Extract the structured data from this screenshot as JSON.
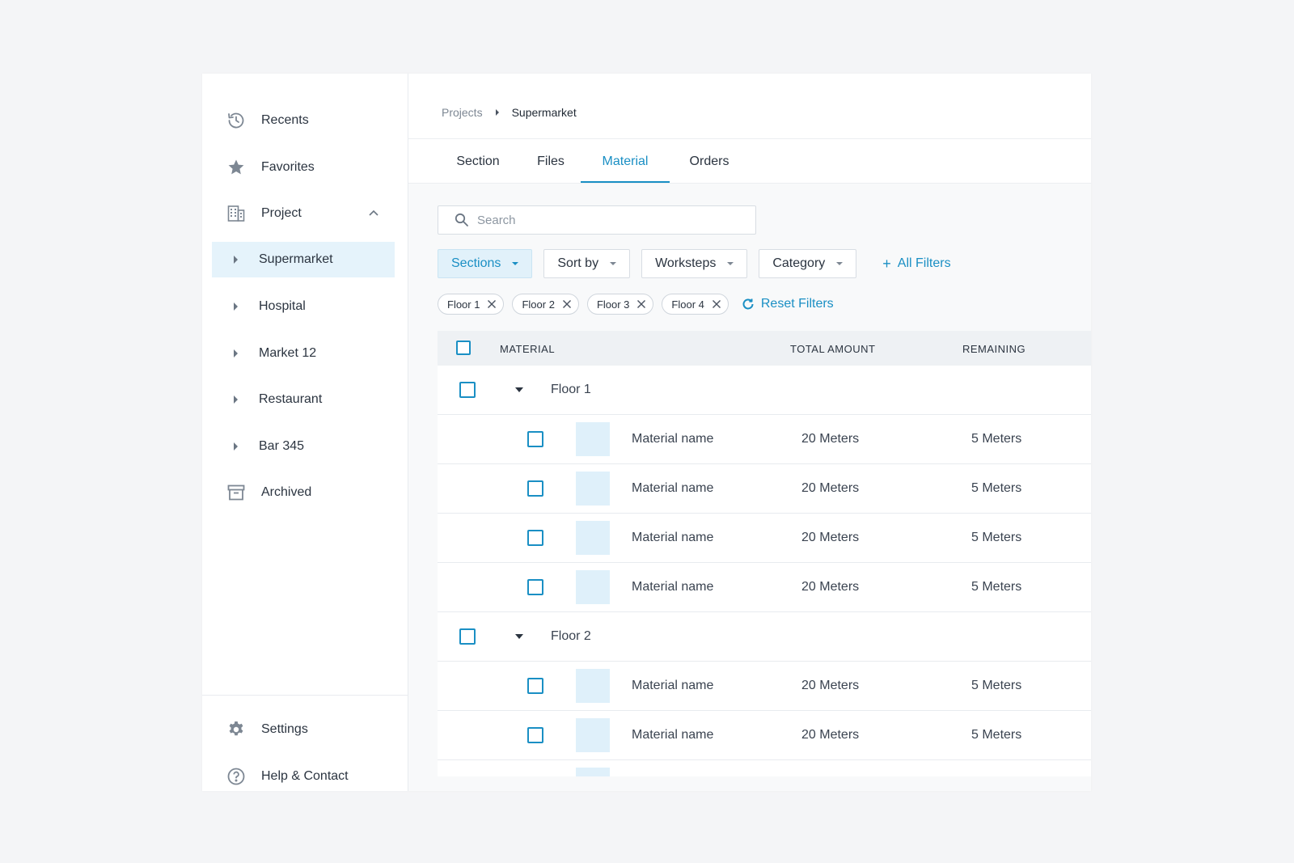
{
  "sidebar": {
    "items": [
      {
        "label": "Recents",
        "icon": "history-icon"
      },
      {
        "label": "Favorites",
        "icon": "star-icon"
      },
      {
        "label": "Project",
        "icon": "building-icon"
      }
    ],
    "projects": [
      {
        "label": "Supermarket",
        "active": true
      },
      {
        "label": "Hospital"
      },
      {
        "label": "Market 12"
      },
      {
        "label": "Restaurant"
      },
      {
        "label": "Bar 345"
      }
    ],
    "archived": {
      "label": "Archived",
      "icon": "archive-icon"
    },
    "footer": [
      {
        "label": "Settings",
        "icon": "gear-icon"
      },
      {
        "label": "Help & Contact",
        "icon": "help-icon"
      }
    ]
  },
  "breadcrumb": {
    "root": "Projects",
    "current": "Supermarket"
  },
  "tabs": [
    {
      "label": "Section"
    },
    {
      "label": "Files"
    },
    {
      "label": "Material",
      "active": true
    },
    {
      "label": "Orders"
    }
  ],
  "search": {
    "placeholder": "Search",
    "value": ""
  },
  "filters": {
    "buttons": [
      {
        "label": "Sections",
        "active": true
      },
      {
        "label": "Sort by"
      },
      {
        "label": "Worksteps"
      },
      {
        "label": "Category"
      }
    ],
    "all_filters_label": "All Filters",
    "chips": [
      "Floor 1",
      "Floor 2",
      "Floor 3",
      "Floor 4"
    ],
    "reset_label": "Reset Filters"
  },
  "table": {
    "headers": {
      "material": "MATERIAL",
      "total": "TOTAL AMOUNT",
      "remaining": "REMAINING"
    },
    "groups": [
      {
        "name": "Floor 1",
        "rows": [
          {
            "material": "Material name",
            "total": "20 Meters",
            "remaining": "5 Meters"
          },
          {
            "material": "Material name",
            "total": "20 Meters",
            "remaining": "5 Meters"
          },
          {
            "material": "Material name",
            "total": "20 Meters",
            "remaining": "5 Meters"
          },
          {
            "material": "Material name",
            "total": "20 Meters",
            "remaining": "5 Meters"
          }
        ]
      },
      {
        "name": "Floor 2",
        "rows": [
          {
            "material": "Material name",
            "total": "20 Meters",
            "remaining": "5 Meters"
          },
          {
            "material": "Material name",
            "total": "20 Meters",
            "remaining": "5 Meters"
          }
        ]
      }
    ]
  },
  "colors": {
    "accent": "#1a8fc4",
    "active_bg": "#e5f3fb",
    "thumb": "#dff0fa"
  }
}
